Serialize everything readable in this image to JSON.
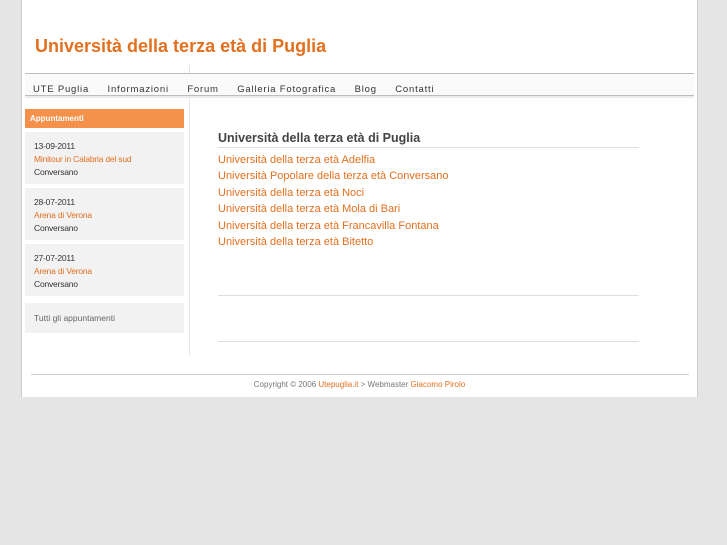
{
  "site": {
    "title": "Università della terza età di Puglia"
  },
  "nav": {
    "items": [
      {
        "label": "UTE Puglia"
      },
      {
        "label": "Informazioni"
      },
      {
        "label": "Forum"
      },
      {
        "label": "Galleria Fotografica"
      },
      {
        "label": "Blog"
      },
      {
        "label": "Contatti"
      }
    ]
  },
  "sidebar": {
    "header": "Appuntamenti",
    "events": [
      {
        "date": "13-09-2011",
        "title": "Minitour in Calabria del sud",
        "place": "Conversano"
      },
      {
        "date": "28-07-2011",
        "title": "Arena di Verona",
        "place": "Conversano"
      },
      {
        "date": "27-07-2011",
        "title": "Arena di Verona",
        "place": "Conversano"
      }
    ],
    "all_link": "Tutti gli appuntamenti"
  },
  "main": {
    "heading": "Università della terza età di Puglia",
    "links": [
      {
        "label": "Università della terza età Adelfia"
      },
      {
        "label": "Università Popolare della terza età Conversano"
      },
      {
        "label": "Università della terza età Noci"
      },
      {
        "label": "Università della terza età  Mola di Bari"
      },
      {
        "label": "Università della terza età Francavilla Fontana"
      },
      {
        "label": "Università della terza età Bitetto"
      }
    ]
  },
  "footer": {
    "copyright": "Copyright © 2006 ",
    "site_link": "Utepuglia.it",
    "separator": " > Webmaster ",
    "webmaster_link": "Giacomo Pirolo"
  },
  "colors": {
    "accent": "#e3701f",
    "sidebar_header_bg": "#f4914a",
    "page_bg": "#e5e5e5"
  }
}
